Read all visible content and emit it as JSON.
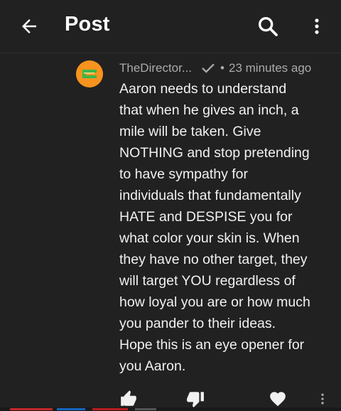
{
  "header": {
    "title": "Post",
    "back_icon": "arrow-left-icon",
    "search_icon": "search-icon",
    "more_icon": "more-vertical-icon"
  },
  "comment": {
    "author": "TheDirector...",
    "timestamp": "23 minutes ago",
    "separator": "•",
    "body": "Aaron needs to understand\nthat when he gives an inch, a\nmile will be taken. Give\nNOTHING and stop pretending\nto have sympathy for\nindividuals that fundamentally\nHATE and DESPISE you for\nwhat color your skin is. When\nthey have no other target, they\nwill target YOU regardless of\nhow loyal you are or how much\nyou pander to their ideas.\nHope this is an eye opener for\nyou Aaron.",
    "avatar_colors": {
      "outer": "#f7931e",
      "inner": "#3cb54a"
    }
  },
  "actions": {
    "like_icon": "thumbs-up-icon",
    "dislike_icon": "thumbs-down-icon",
    "heart_icon": "heart-icon",
    "more_icon": "more-vertical-icon"
  },
  "colors": {
    "background": "#212121",
    "text": "#f1f1f1",
    "secondary_text": "#aaaaaa"
  }
}
